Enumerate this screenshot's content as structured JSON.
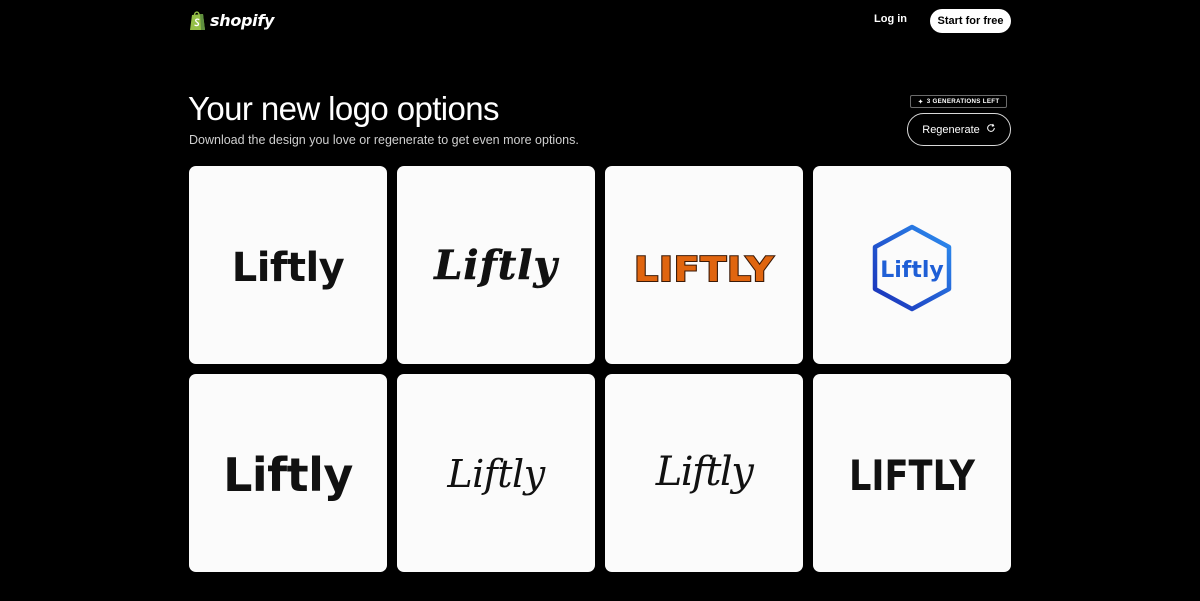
{
  "header": {
    "brand_name": "shopify",
    "brand_icon": "shopping-bag-icon",
    "brand_color": "#95bf47",
    "login_label": "Log in",
    "start_label": "Start for free"
  },
  "main": {
    "title": "Your new logo options",
    "subtitle": "Download the design you love or regenerate to get even more options.",
    "generations_badge": "3 GENERATIONS LEFT",
    "regenerate_label": "Regenerate",
    "regenerate_icon": "refresh-icon"
  },
  "logos": [
    {
      "text": "Liftly",
      "style": "bold-sans",
      "color": "#111111"
    },
    {
      "text": "Liftly",
      "style": "brush-script",
      "color": "#111111"
    },
    {
      "text": "LIFTLY",
      "style": "retro-bubble",
      "color": "#e0650f",
      "outline": "#3a1a08"
    },
    {
      "text": "Liftly",
      "style": "hexagon-badge",
      "color": "#1f5fd6"
    },
    {
      "text": "Liftly",
      "style": "bold-sans-large",
      "color": "#111111"
    },
    {
      "text": "Liftly",
      "style": "elegant-script",
      "color": "#111111"
    },
    {
      "text": "Liftly",
      "style": "signature-script",
      "color": "#111111"
    },
    {
      "text": "LIFTLY",
      "style": "condensed-caps",
      "color": "#111111"
    }
  ]
}
